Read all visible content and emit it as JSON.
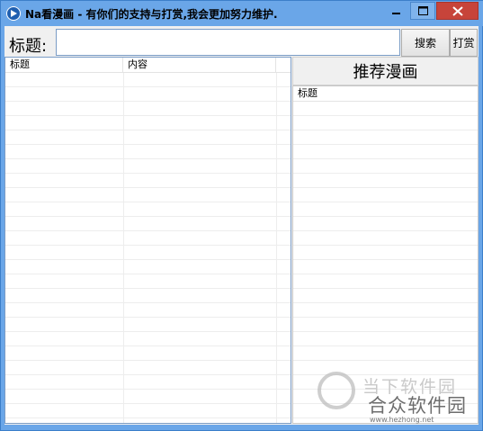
{
  "window": {
    "title": "Na看漫画 - 有你们的支持与打赏,我会更加努力维护."
  },
  "search_bar": {
    "label": "标题:",
    "input_value": "",
    "search_button": "搜索",
    "reward_button": "打赏"
  },
  "results_list": {
    "columns": [
      "标题",
      "内容"
    ]
  },
  "recommend": {
    "header": "推荐漫画",
    "columns": [
      "标题"
    ]
  },
  "watermark": {
    "top": "当下软件园",
    "main": "合众软件园",
    "url": "www.hezhong.net"
  },
  "icons": {
    "app": "play-icon",
    "minimize": "minimize-icon",
    "maximize": "maximize-icon",
    "close": "close-icon"
  },
  "colors": {
    "titlebar": "#6aa6e8",
    "close_button": "#c7443a",
    "client_bg": "#f0f0f0",
    "border_accent": "#7a9cc6"
  }
}
